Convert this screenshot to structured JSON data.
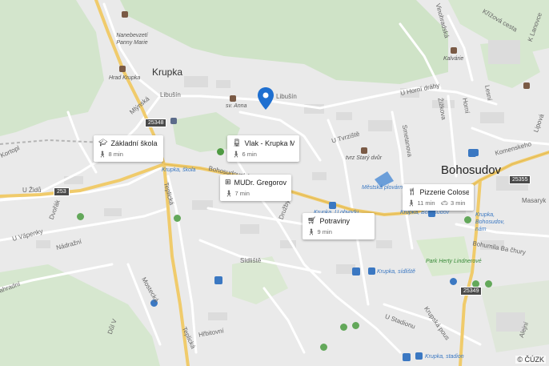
{
  "places": {
    "krupka": "Krupka",
    "bohosudov": "Bohosudov"
  },
  "streets": {
    "libusin1": "Libušín",
    "libusin2": "Libušín",
    "mlynska": "Mlýnská",
    "u_horni_drahy": "U Horní dráhy",
    "u_tvrziste": "U Tvrziště",
    "zizkova": "Žižkova",
    "horni": "Horní",
    "smetanova": "Smetanova",
    "komenskeho": "Komenskeho",
    "u_zidu": "U Židů",
    "dvorak": "Dvořák",
    "vapenky": "U Vápenky",
    "nadrazni": "Nádražní",
    "teplicka1": "Teplická",
    "teplicka2": "Teplická",
    "bohosudovska": "Bohosudovská",
    "sidliste": "Sídliště",
    "hrbitovni": "Hřbitovní",
    "u_stadionu": "U Stadionu",
    "bohumila": "Bohumila Ba čhury",
    "masaryk": "Masaryk",
    "lipova": "Lipová",
    "krizova": "Křížová cesta",
    "k_lanovce": "K Lanovce",
    "vinohradska": "Vinohradská",
    "kortopl": "Kortopl",
    "zahradni": "Zahradní",
    "dul_v": "Důl V",
    "druzby": "Družby",
    "lesni": "Lesní",
    "krupska_poust": "Krupská pous",
    "mostecka": "Mostecká",
    "ahoj": "Alejní"
  },
  "pois": {
    "nanebevzeti": "Nanebevzetí Panny Marie",
    "hrad": "Hrad Krupka",
    "sv_anna": "sv. Anna",
    "kalvarie": "Kalvárie",
    "tvrz": "tvrz Starý dvůr",
    "mestska_plovarna": "Městská plovárna",
    "park": "Park Herty Lindnerové"
  },
  "stops": {
    "krupka_skola": "Krupka, škola",
    "krupka_u_obvodu": "Krupka, U obvodu",
    "krupka_bohosudov": "Krupka, Bohosudov, nám",
    "krupka_sidliste": "Krupka, sídliště",
    "krupka_stadion": "Krupka, stadion",
    "krupka_kolo": "Krupka, škola",
    "krupka_bohosudov_label": "Krupka, Bohosudov"
  },
  "roads": {
    "r25348": "25348",
    "r253": "253",
    "r25355": "25355",
    "r25349": "25349"
  },
  "cards": [
    {
      "name": "Základní škola Kr...",
      "time": "8 min",
      "icon": "school-icon"
    },
    {
      "name": "Vlak - Krupka Měs...",
      "time": "6 min",
      "icon": "train-icon"
    },
    {
      "name": "MUDr. Gregorová ...",
      "time": "7 min",
      "icon": "medical-icon"
    },
    {
      "name": "Potraviny",
      "time": "9 min",
      "icon": "cart-icon"
    },
    {
      "name": "Pizzerie Coloseum",
      "time": "11 min",
      "time_car": "3 min",
      "icon": "restaurant-icon"
    }
  ],
  "attribution": "© ČÚZK",
  "colors": {
    "pin": "#1e6fd0",
    "water": "#6b9ed9",
    "forest": "#cde3c6",
    "road_major": "#f3d27a",
    "road_minor": "#ffffff",
    "base": "#eaeaea"
  }
}
